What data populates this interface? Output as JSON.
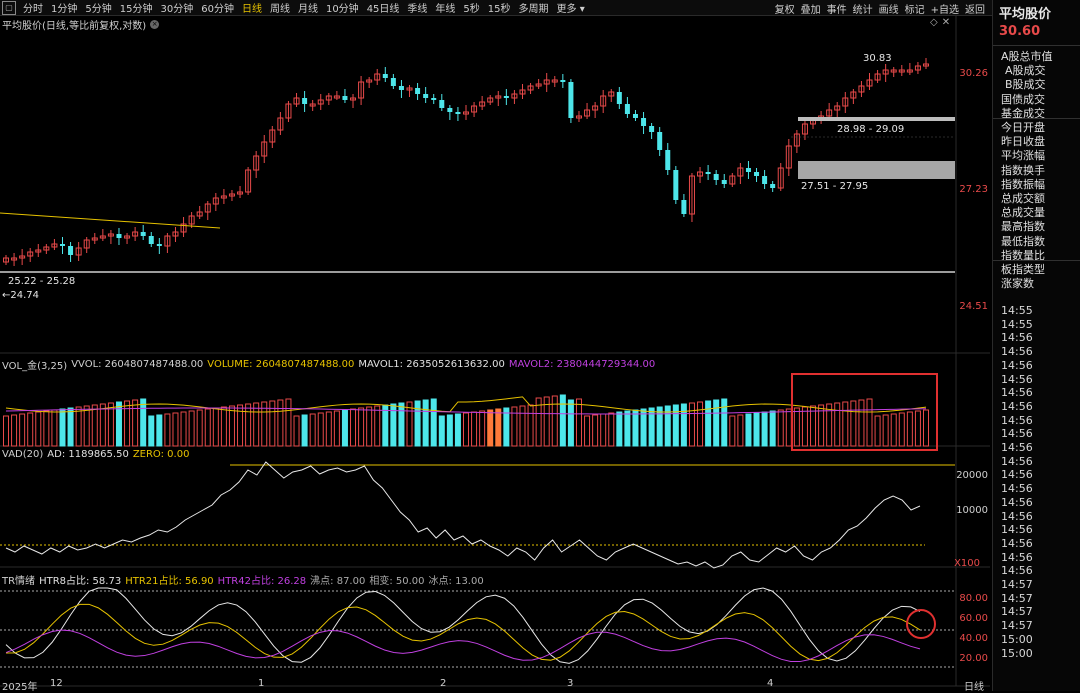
{
  "toolbar": {
    "periods": [
      "分时",
      "1分钟",
      "5分钟",
      "15分钟",
      "30分钟",
      "60分钟",
      "日线",
      "周线",
      "月线",
      "10分钟",
      "45日线",
      "季线",
      "年线",
      "5秒",
      "15秒",
      "多周期",
      "更多"
    ],
    "active_index": 6,
    "tools": [
      "复权",
      "叠加",
      "事件",
      "统计",
      "画线",
      "标记",
      "+自选",
      "返回"
    ]
  },
  "chart": {
    "title": "平均股价(日线,等比前复权,对数)",
    "price_axis": [
      "30.26",
      "27.23",
      "24.51"
    ],
    "annotations": {
      "high": "30.83",
      "zone_upper": "28.98 - 29.09",
      "zone_lower": "27.51 - 27.95",
      "zone_bottom": "25.22 - 25.28",
      "low": "←24.74"
    }
  },
  "vol": {
    "name": "VOL_金(3,25)",
    "vvol": "VVOL: 2604807487488.00",
    "volume": "VOLUME: 2604807487488.00",
    "mavol1": "MAVOL1: 2635052613632.00",
    "mavol2": "MAVOL2: 2380444729344.00"
  },
  "vad": {
    "name": "VAD(20)",
    "ad": "AD: 1189865.50",
    "zero": "ZERO: 0.00",
    "axis": [
      "20000",
      "10000",
      "X100"
    ]
  },
  "tr": {
    "name": "TR情绪",
    "htr8": "HTR8占比: 58.73",
    "htr21": "HTR21占比: 56.90",
    "htr42": "HTR42占比: 26.28",
    "boil": "沸点: 87.00",
    "zero_line": "相变: 50.00",
    "ice": "冰点: 13.00",
    "axis": [
      "80.00",
      "60.00",
      "40.00",
      "20.00"
    ]
  },
  "xaxis": {
    "labels": [
      "2025年",
      "12",
      "1",
      "2",
      "3",
      "4"
    ],
    "period": "日线"
  },
  "sidebar": {
    "title": "平均股价",
    "price": "30.60",
    "rows": [
      "A股总市值",
      "A股成交",
      "B股成交",
      "国债成交",
      "基金成交",
      "今日开盘",
      "昨日收盘",
      "平均涨幅",
      "指数换手",
      "指数振幅",
      "总成交额",
      "总成交量",
      "最高指数",
      "最低指数",
      "指数量比",
      "板指类型",
      "涨家数"
    ],
    "times": [
      "14:55",
      "14:55",
      "14:56",
      "14:56",
      "14:56",
      "14:56",
      "14:56",
      "14:56",
      "14:56",
      "14:56",
      "14:56",
      "14:56",
      "14:56",
      "14:56",
      "14:56",
      "14:56",
      "14:56",
      "14:56",
      "14:56",
      "14:56",
      "14:57",
      "14:57",
      "14:57",
      "14:57",
      "15:00",
      "15:00"
    ]
  },
  "colors": {
    "up": "#e84a4a",
    "down": "#4de6ea",
    "accent": "#e6c200",
    "purple": "#c040e0",
    "highlight": "#ff7a3a"
  }
}
